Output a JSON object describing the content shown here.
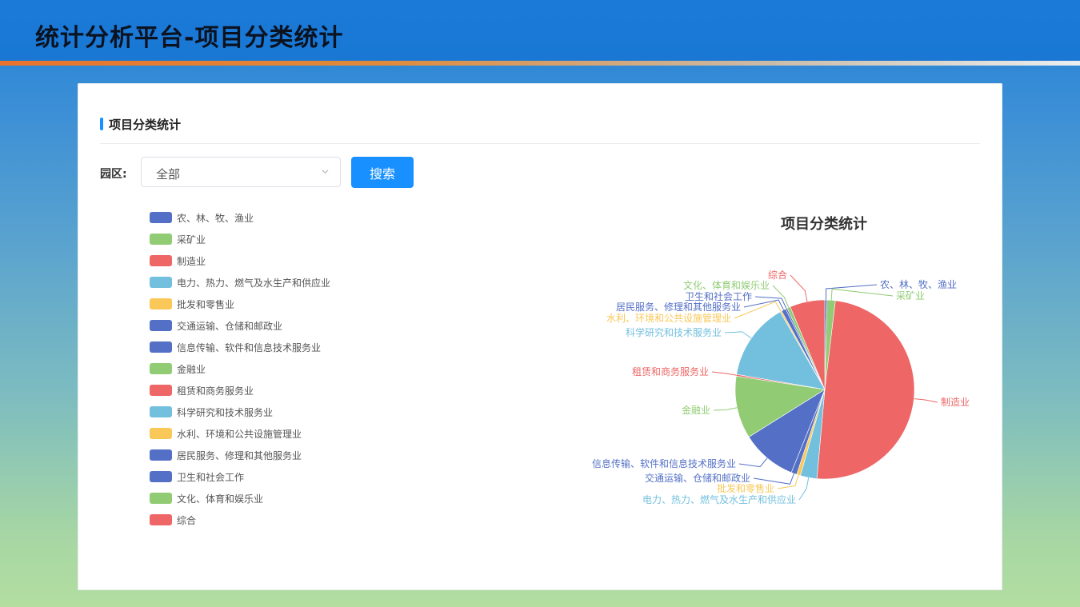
{
  "header": {
    "title": "统计分析平台-项目分类统计"
  },
  "panel": {
    "title": "项目分类统计"
  },
  "filter": {
    "label": "园区:",
    "select_value": "全部",
    "search_label": "搜索"
  },
  "colors": {
    "blue": "#5470c6",
    "green": "#91cc75",
    "red": "#ee6666",
    "cyan": "#73c0de",
    "yellow": "#fac858",
    "accent": "#1890ff"
  },
  "chart_data": {
    "type": "pie",
    "title": "项目分类统计",
    "legend": "left",
    "slices": [
      {
        "name": "农、林、牧、渔业",
        "value": 0.4,
        "color": "#5470c6"
      },
      {
        "name": "采矿业",
        "value": 1.5,
        "color": "#91cc75"
      },
      {
        "name": "制造业",
        "value": 49.5,
        "color": "#ee6666"
      },
      {
        "name": "电力、热力、燃气及水生产和供应业",
        "value": 3.0,
        "color": "#73c0de"
      },
      {
        "name": "批发和零售业",
        "value": 0.7,
        "color": "#fac858"
      },
      {
        "name": "交通运输、仓储和邮政业",
        "value": 1.0,
        "color": "#5470c6"
      },
      {
        "name": "信息传输、软件和信息技术服务业",
        "value": 10.0,
        "color": "#5470c6"
      },
      {
        "name": "金融业",
        "value": 11.3,
        "color": "#91cc75"
      },
      {
        "name": "租赁和商务服务业",
        "value": 0.3,
        "color": "#ee6666"
      },
      {
        "name": "科学研究和技术服务业",
        "value": 14.0,
        "color": "#73c0de"
      },
      {
        "name": "水利、环境和公共设施管理业",
        "value": 0.3,
        "color": "#fac858"
      },
      {
        "name": "居民服务、修理和其他服务业",
        "value": 0.8,
        "color": "#5470c6"
      },
      {
        "name": "卫生和社会工作",
        "value": 0.3,
        "color": "#5470c6"
      },
      {
        "name": "文化、体育和娱乐业",
        "value": 0.6,
        "color": "#91cc75"
      },
      {
        "name": "综合",
        "value": 6.3,
        "color": "#ee6666"
      }
    ]
  }
}
